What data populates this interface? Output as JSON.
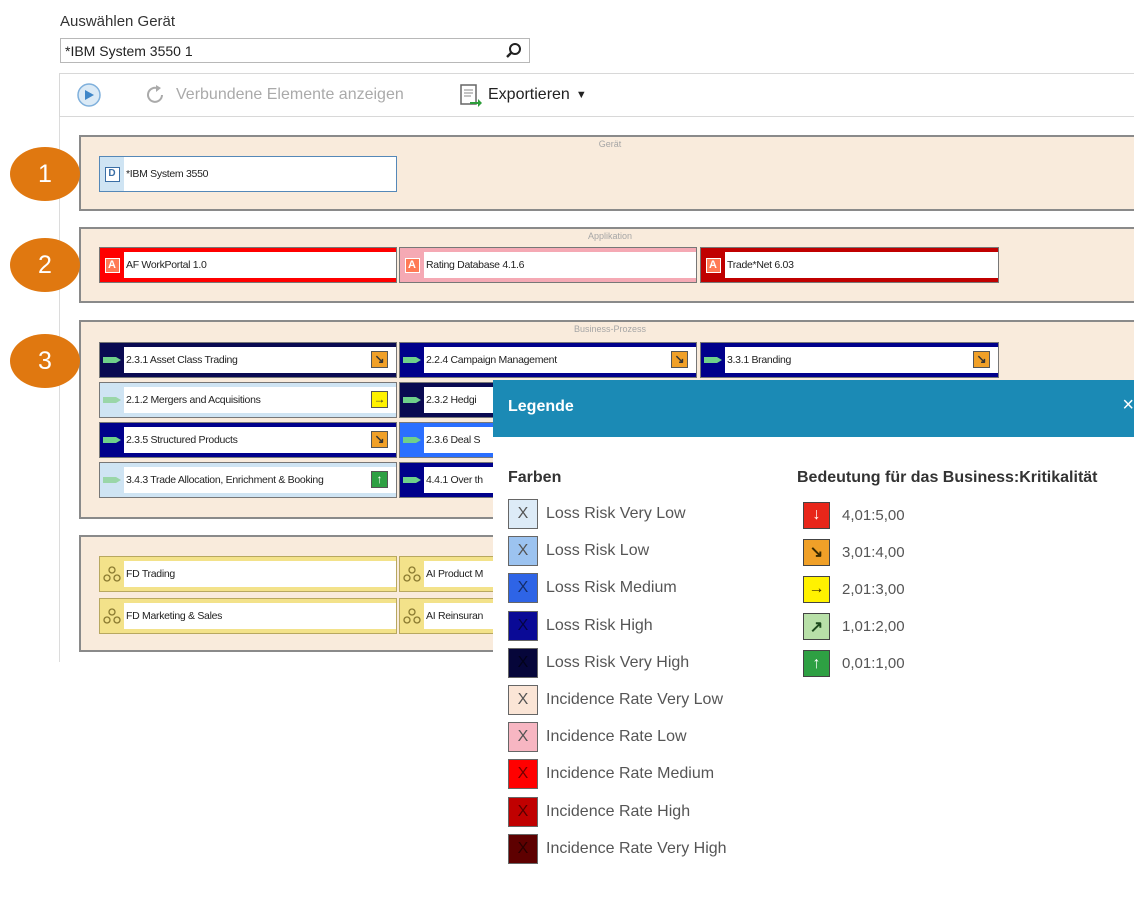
{
  "header": {
    "device_label": "Auswählen Gerät",
    "device_value": "*IBM System 3550 1"
  },
  "toolbar": {
    "connected_label": "Verbundene Elemente anzeigen",
    "export_label": "Exportieren"
  },
  "markers": [
    "1",
    "2",
    "3"
  ],
  "groups": {
    "geraet": {
      "title": "Gerät",
      "nodes": [
        {
          "badge": "D",
          "label": "*IBM System 3550"
        }
      ]
    },
    "application": {
      "title": "Applikation",
      "nodes": [
        {
          "badge": "A",
          "label": "AF WorkPortal 1.0",
          "color": "#ff0000"
        },
        {
          "badge": "A",
          "label": "Rating Database 4.1.6",
          "color": "#f5a9b4"
        },
        {
          "badge": "A",
          "label": "Trade*Net 6.03",
          "color": "#c00000"
        }
      ]
    },
    "business": {
      "title": "Business-Prozess",
      "nodes": [
        {
          "label": "2.3.1 Asset Class Trading",
          "color": "#0a0a52",
          "crit": "3,01:4,00"
        },
        {
          "label": "2.2.4 Campaign Management",
          "color": "#00008b",
          "crit": "3,01:4,00"
        },
        {
          "label": "3.3.1 Branding",
          "color": "#00008b",
          "crit": "3,01:4,00"
        },
        {
          "label": "2.1.2 Mergers and Acquisitions",
          "color": "#cfe4f3",
          "crit": "2,01:3,00"
        },
        {
          "label": "2.3.2 Hedgi",
          "color": "#0a0a52"
        },
        {
          "label": "2.3.5 Structured Products",
          "color": "#00008b",
          "crit": "3,01:4,00"
        },
        {
          "label": "2.3.6 Deal S",
          "color": "#2b6fff"
        },
        {
          "label": "3.4.3 Trade Allocation, Enrichment & Booking",
          "color": "#cfe4f3",
          "crit": "0,01:1,00"
        },
        {
          "label": "4.4.1 Over th",
          "color": "#00008b"
        }
      ]
    },
    "organization": {
      "nodes": [
        {
          "label": "FD Trading"
        },
        {
          "label": "AI Product M"
        },
        {
          "label": "FD Marketing & Sales"
        },
        {
          "label": "AI Reinsuran"
        }
      ]
    }
  },
  "legend": {
    "title": "Legende",
    "close": "×",
    "colors_title": "Farben",
    "criticality_title": "Bedeutung für das Business:Kritikalität",
    "colors": [
      {
        "label": "Loss Risk Very Low",
        "color": "#ddebf7"
      },
      {
        "label": "Loss Risk Low",
        "color": "#9cc3f0"
      },
      {
        "label": "Loss Risk Medium",
        "color": "#2e64e6"
      },
      {
        "label": "Loss Risk High",
        "color": "#0a0a96"
      },
      {
        "label": "Loss Risk Very High",
        "color": "#06063a"
      },
      {
        "label": "Incidence Rate Very Low",
        "color": "#fbe5d6"
      },
      {
        "label": "Incidence Rate Low",
        "color": "#f7b6c2"
      },
      {
        "label": "Incidence Rate Medium",
        "color": "#ff0000"
      },
      {
        "label": "Incidence Rate High",
        "color": "#c00000"
      },
      {
        "label": "Incidence Rate Very High",
        "color": "#5e0000"
      }
    ],
    "criticality": [
      {
        "label": "4,01:5,00",
        "color": "#e8261a",
        "icon": "arrow-down-icon"
      },
      {
        "label": "3,01:4,00",
        "color": "#f0a028",
        "icon": "arrow-down-right-icon"
      },
      {
        "label": "2,01:3,00",
        "color": "#fff200",
        "icon": "arrow-right-icon"
      },
      {
        "label": "1,01:2,00",
        "color": "#b8e0a8",
        "icon": "arrow-up-right-icon"
      },
      {
        "label": "0,01:1,00",
        "color": "#2ea043",
        "icon": "arrow-up-icon"
      }
    ]
  }
}
